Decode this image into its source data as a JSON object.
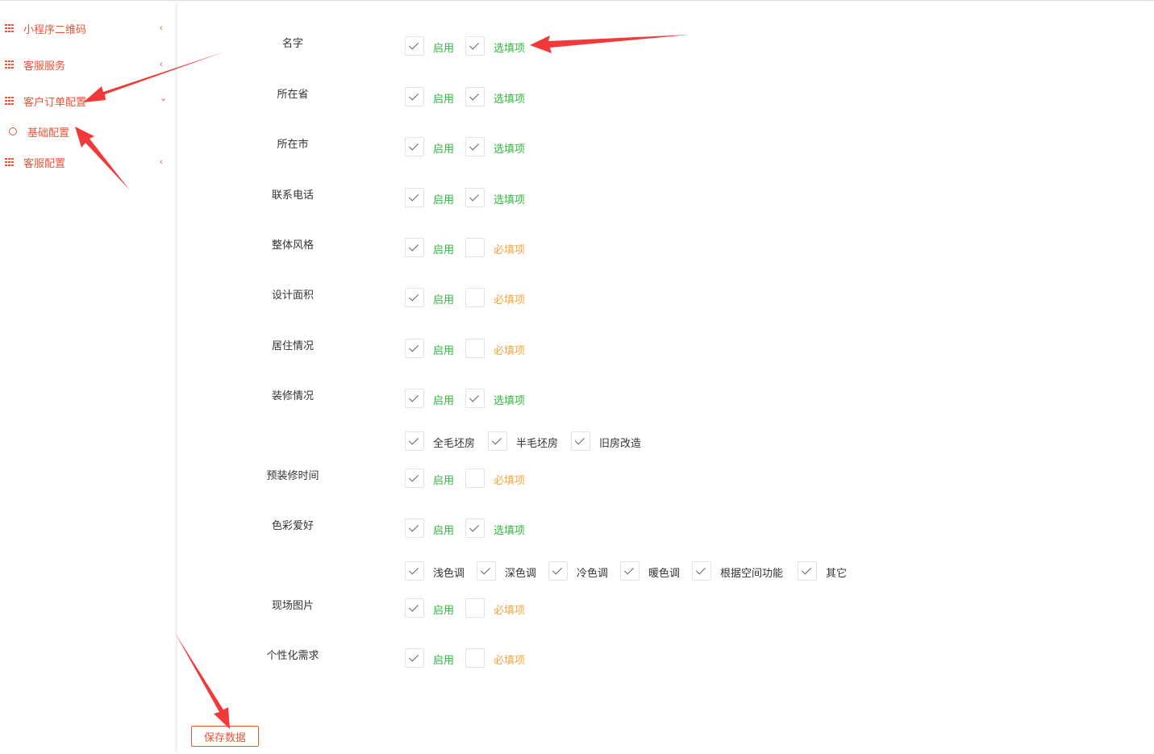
{
  "sidebar": {
    "items": [
      {
        "label": "小程序二维码",
        "chevron": "‹"
      },
      {
        "label": "客服服务",
        "chevron": "‹"
      },
      {
        "label": "客户订单配置",
        "chevron": "⌄"
      },
      {
        "label": "客服配置",
        "chevron": "‹"
      }
    ],
    "sub_item": {
      "label": "基础配置"
    }
  },
  "form": {
    "rows": [
      {
        "label": "名字",
        "enable": "启用",
        "enabled": true,
        "req_label": "选填项",
        "optional": true
      },
      {
        "label": "所在省",
        "enable": "启用",
        "enabled": true,
        "req_label": "选填项",
        "optional": true
      },
      {
        "label": "所在市",
        "enable": "启用",
        "enabled": true,
        "req_label": "选填项",
        "optional": true
      },
      {
        "label": "联系电话",
        "enable": "启用",
        "enabled": true,
        "req_label": "选填项",
        "optional": true
      },
      {
        "label": "整体风格",
        "enable": "启用",
        "enabled": true,
        "req_label": "必填项",
        "optional": false
      },
      {
        "label": "设计面积",
        "enable": "启用",
        "enabled": true,
        "req_label": "必填项",
        "optional": false
      },
      {
        "label": "居住情况",
        "enable": "启用",
        "enabled": true,
        "req_label": "必填项",
        "optional": false
      },
      {
        "label": "装修情况",
        "enable": "启用",
        "enabled": true,
        "req_label": "选填项",
        "optional": true
      },
      {
        "label": "预装修时间",
        "enable": "启用",
        "enabled": true,
        "req_label": "必填项",
        "optional": false
      },
      {
        "label": "色彩爱好",
        "enable": "启用",
        "enabled": true,
        "req_label": "选填项",
        "optional": true
      },
      {
        "label": "现场图片",
        "enable": "启用",
        "enabled": true,
        "req_label": "必填项",
        "optional": false
      },
      {
        "label": "个性化需求",
        "enable": "启用",
        "enabled": true,
        "req_label": "必填项",
        "optional": false
      }
    ],
    "decoration_options": [
      "全毛坯房",
      "半毛坯房",
      "旧房改造"
    ],
    "color_options": [
      "浅色调",
      "深色调",
      "冷色调",
      "暖色调",
      "根据空间功能",
      "其它"
    ]
  },
  "save_button": "保存数据",
  "colors": {
    "accent": "#e8553a",
    "green": "#2fb83d",
    "orange": "#f5a53c",
    "annotation": "#f03a3a"
  }
}
